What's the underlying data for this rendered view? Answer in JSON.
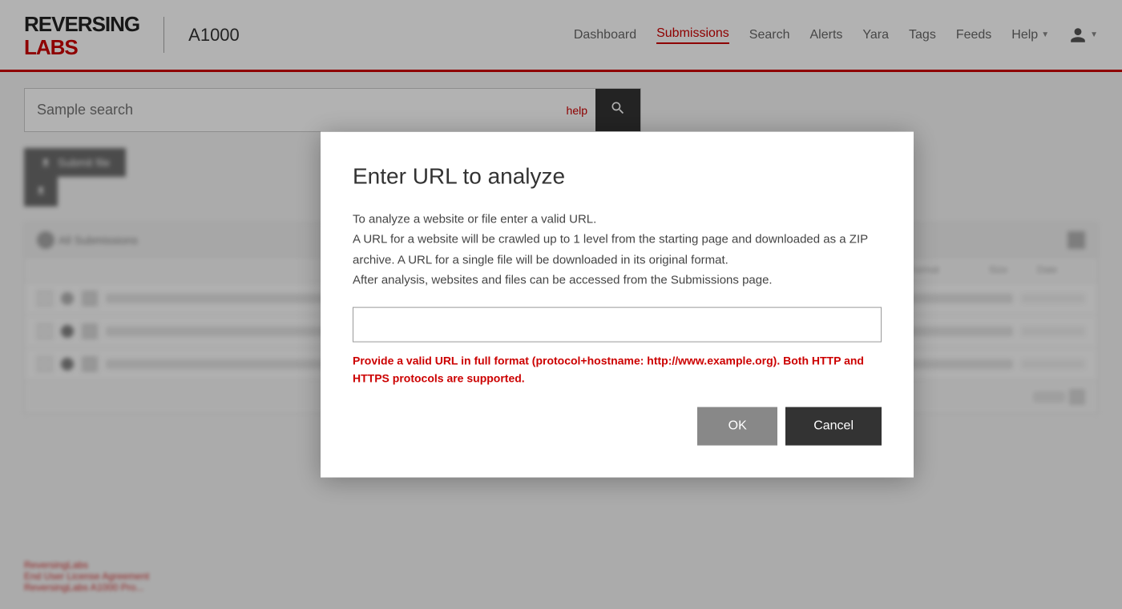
{
  "app": {
    "logo_top": "REVERSING",
    "logo_bottom": "LABS",
    "product": "A1000"
  },
  "nav": {
    "items": [
      {
        "label": "Dashboard",
        "active": false
      },
      {
        "label": "Submissions",
        "active": true
      },
      {
        "label": "Search",
        "active": false
      },
      {
        "label": "Alerts",
        "active": false
      },
      {
        "label": "Yara",
        "active": false
      },
      {
        "label": "Tags",
        "active": false
      },
      {
        "label": "Feeds",
        "active": false
      },
      {
        "label": "Help",
        "active": false
      }
    ]
  },
  "search": {
    "placeholder": "Sample search",
    "help_label": "help"
  },
  "buttons": {
    "submit_file": "Submit file",
    "ok": "OK",
    "cancel": "Cancel"
  },
  "modal": {
    "title": "Enter URL to analyze",
    "description": "To analyze a website or file enter a valid URL.\nA URL for a website will be crawled up to 1 level from the starting page and downloaded as a ZIP archive. A URL for a single file will be downloaded in its original format.\nAfter analysis, websites and files can be accessed from the Submissions page.",
    "url_placeholder": "",
    "url_value": "",
    "error_message": "Provide a valid URL in full format (protocol+hostname: http://www.example.org). Both HTTP and HTTPS protocols are supported."
  },
  "footer": {
    "line1": "ReversingLabs",
    "line2": "End User License Agreement",
    "line3": "ReversingLabs A1000 Pro..."
  },
  "table": {
    "columns": [
      "Format",
      "Size",
      "Date"
    ],
    "rows": [
      {
        "check": false
      },
      {
        "check": false
      },
      {
        "check": false
      }
    ]
  }
}
